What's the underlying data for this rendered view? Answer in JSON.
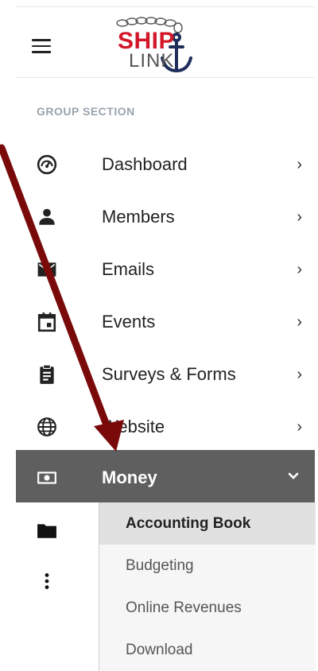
{
  "header": {
    "logo": {
      "line1": "SHIP",
      "line2": "LINK"
    }
  },
  "sidebar": {
    "section_title": "GROUP SECTION",
    "items": [
      {
        "label": "Dashboard",
        "icon": "dashboard-icon"
      },
      {
        "label": "Members",
        "icon": "person-icon"
      },
      {
        "label": "Emails",
        "icon": "email-icon"
      },
      {
        "label": "Events",
        "icon": "calendar-icon"
      },
      {
        "label": "Surveys & Forms",
        "icon": "clipboard-icon"
      },
      {
        "label": "Website",
        "icon": "globe-icon"
      },
      {
        "label": "Money",
        "icon": "money-icon"
      }
    ],
    "extra_icons": [
      "folder-icon",
      "more-vertical-icon"
    ],
    "submenu": [
      "Accounting Book",
      "Budgeting",
      "Online Revenues",
      "Download"
    ]
  },
  "colors": {
    "active_bg": "#5f5f5f",
    "submenu_bg": "#f6f6f6",
    "selected_bg": "#e1e1e1",
    "logo_red": "#d3172a",
    "logo_navy": "#1e2d5a",
    "arrow": "#7a0a0a"
  }
}
